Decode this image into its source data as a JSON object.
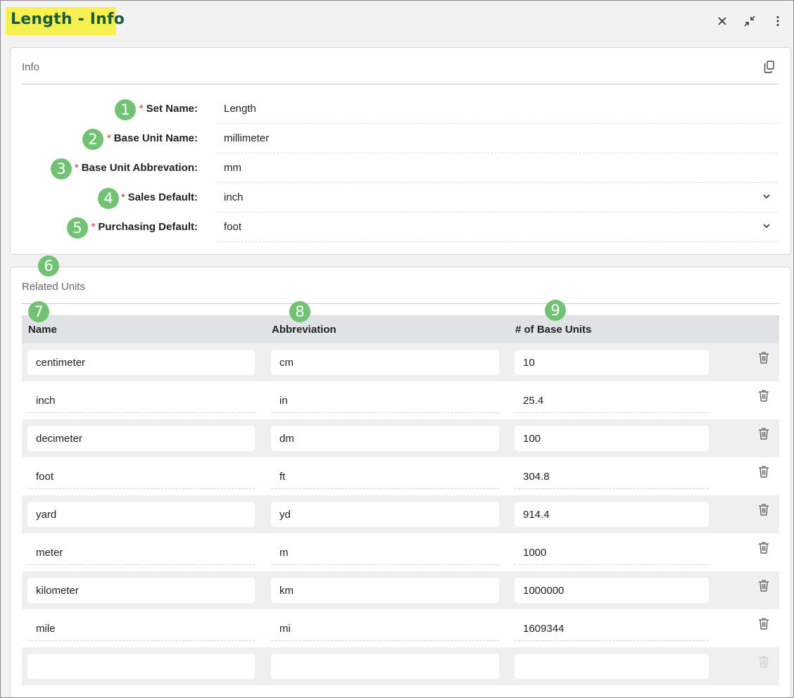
{
  "window": {
    "title": "Length - Info",
    "close_icon": "close-icon",
    "collapse_icon": "collapse-icon",
    "menu_icon": "more-vertical-icon"
  },
  "info": {
    "heading": "Info",
    "copy_icon": "copy-icon",
    "fields": [
      {
        "badge": "1",
        "required_mark": "*",
        "label": "Set Name:",
        "value": "Length",
        "type": "text"
      },
      {
        "badge": "2",
        "required_mark": "*",
        "label": "Base Unit Name:",
        "value": "millimeter",
        "type": "text"
      },
      {
        "badge": "3",
        "required_mark": "*",
        "label": "Base Unit Abbrevation:",
        "value": "mm",
        "type": "text"
      },
      {
        "badge": "4",
        "required_mark": "*",
        "label": "Sales Default:",
        "value": "inch",
        "type": "select"
      },
      {
        "badge": "5",
        "required_mark": "*",
        "label": "Purchasing Default:",
        "value": "foot",
        "type": "select"
      }
    ]
  },
  "related": {
    "badge": "6",
    "heading": "Related Units",
    "columns": [
      {
        "badge": "7",
        "label": "Name"
      },
      {
        "badge": "8",
        "label": "Abbreviation"
      },
      {
        "badge": "9",
        "label": "# of Base Units"
      }
    ],
    "rows": [
      {
        "name": "centimeter",
        "abbr": "cm",
        "base": "10"
      },
      {
        "name": "inch",
        "abbr": "in",
        "base": "25.4"
      },
      {
        "name": "decimeter",
        "abbr": "dm",
        "base": "100"
      },
      {
        "name": "foot",
        "abbr": "ft",
        "base": "304.8"
      },
      {
        "name": "yard",
        "abbr": "yd",
        "base": "914.4"
      },
      {
        "name": "meter",
        "abbr": "m",
        "base": "1000"
      },
      {
        "name": "kilometer",
        "abbr": "km",
        "base": "1000000"
      },
      {
        "name": "mile",
        "abbr": "mi",
        "base": "1609344"
      },
      {
        "name": "",
        "abbr": "",
        "base": ""
      }
    ],
    "delete_icon": "trash-icon"
  },
  "colors": {
    "title_highlight": "#f6f151",
    "title_text": "#1c5a3c",
    "badge": "#72c274",
    "required": "#d63333"
  }
}
